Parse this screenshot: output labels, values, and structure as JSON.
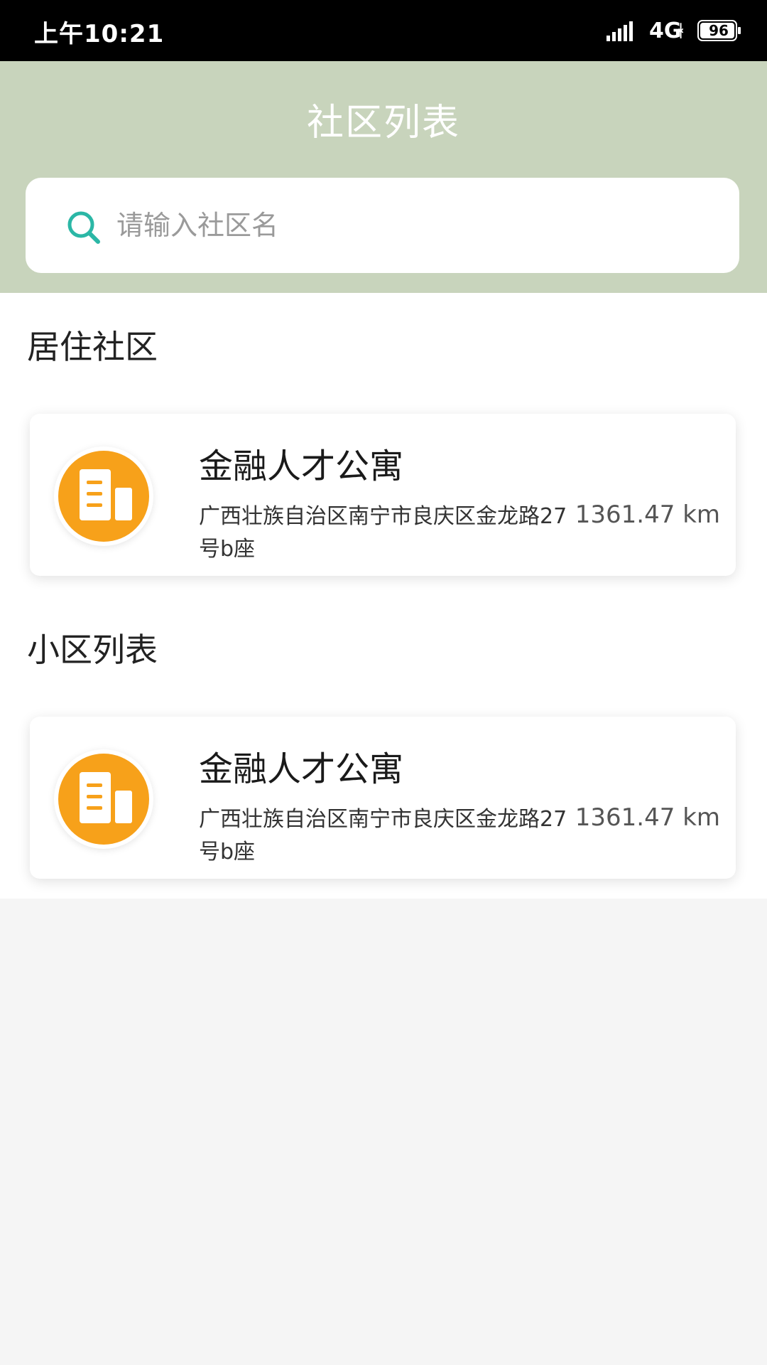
{
  "status_bar": {
    "time": "上午10:21",
    "network": "4G",
    "battery": "96"
  },
  "header": {
    "title": "社区列表"
  },
  "search": {
    "placeholder": "请输入社区名",
    "value": "",
    "icon": "search-icon"
  },
  "sections": [
    {
      "title": "居住社区",
      "items": [
        {
          "name": "金融人才公寓",
          "address": "广西壮族自治区南宁市良庆区金龙路27号b座",
          "distance": "1361.47 km",
          "icon": "building-icon"
        }
      ]
    },
    {
      "title": "小区列表",
      "items": [
        {
          "name": "金融人才公寓",
          "address": "广西壮族自治区南宁市良庆区金龙路27号b座",
          "distance": "1361.47 km",
          "icon": "building-icon"
        }
      ]
    }
  ],
  "colors": {
    "header_bg": "#c8d4bc",
    "accent_teal": "#2bb7a6",
    "icon_orange": "#f7a11a",
    "page_bg": "#f5f5f5"
  }
}
